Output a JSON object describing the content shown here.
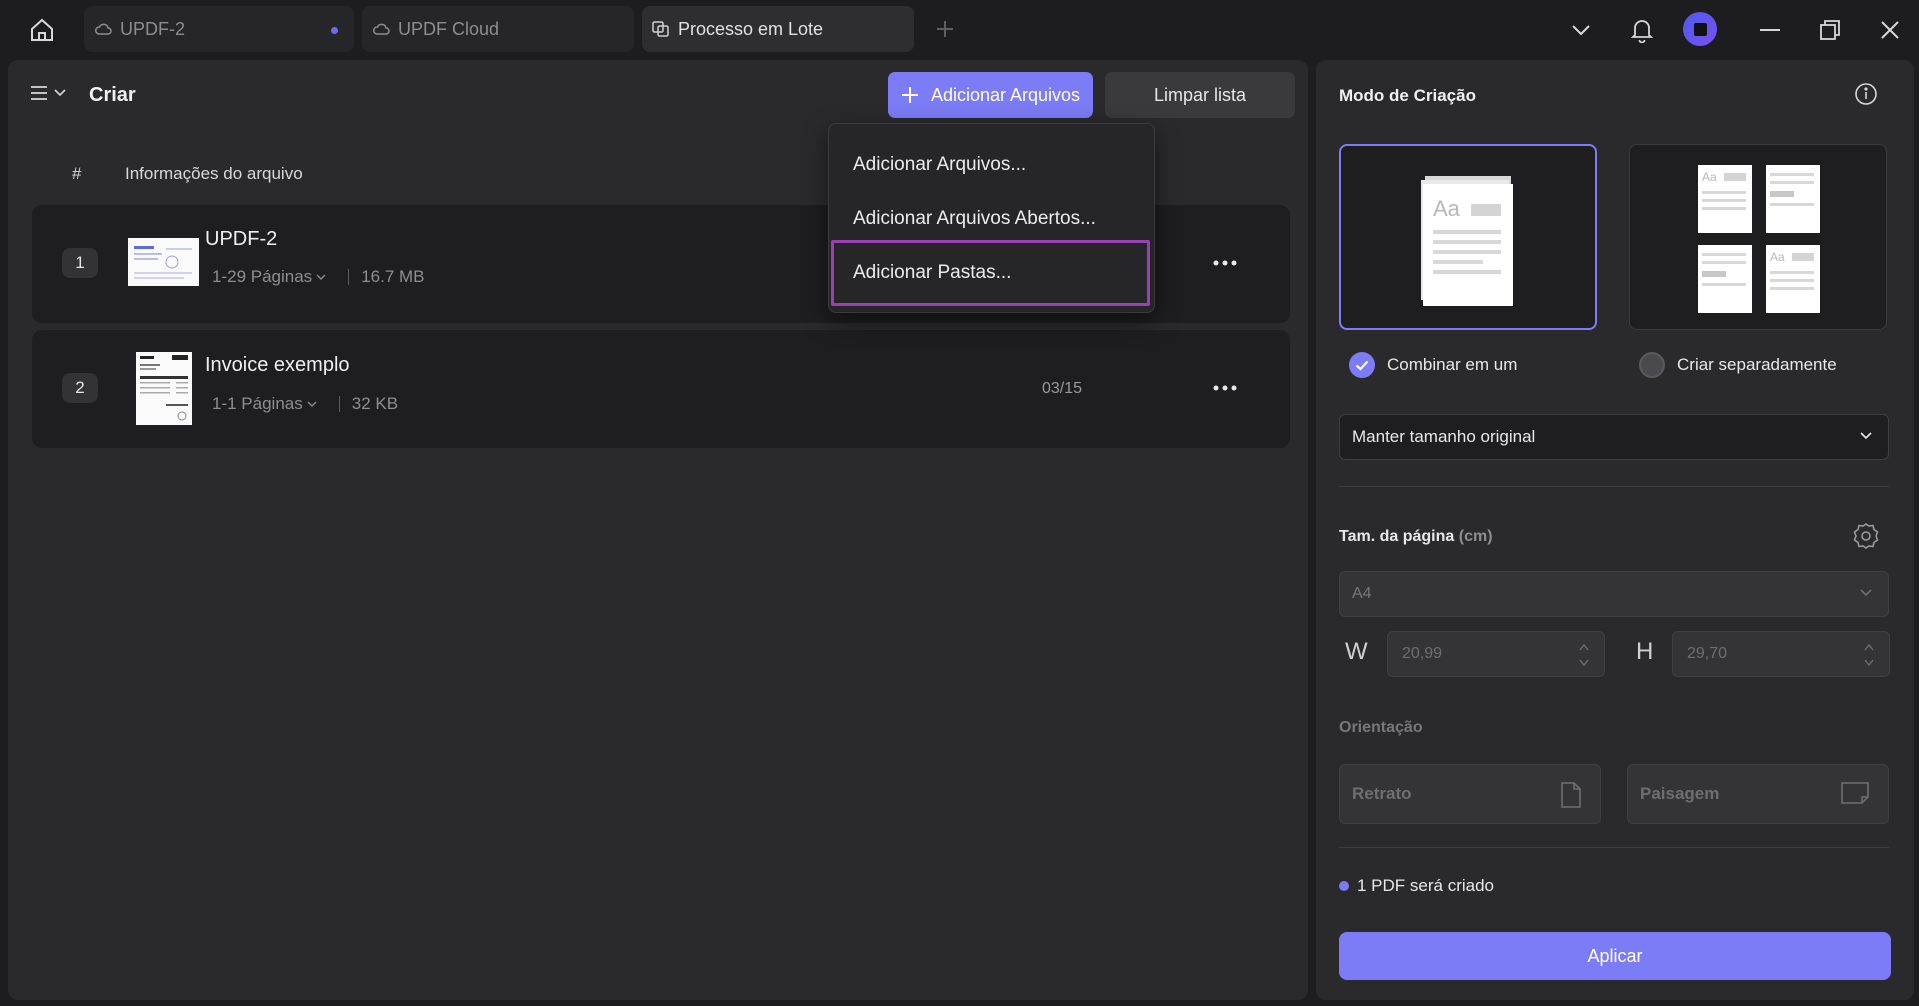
{
  "titlebar": {
    "tabs": [
      {
        "label": "UPDF-2"
      },
      {
        "label": "UPDF Cloud"
      },
      {
        "label": "Processo em Lote"
      }
    ]
  },
  "left": {
    "title": "Criar",
    "add_button": "Adicionar Arquivos",
    "clear_button": "Limpar lista",
    "columns": {
      "index": "#",
      "info": "Informações do arquivo"
    },
    "files": [
      {
        "index": "1",
        "name": "UPDF-2",
        "pages": "1-29 Páginas",
        "size": "16.7 MB",
        "range": ""
      },
      {
        "index": "2",
        "name": "Invoice exemplo",
        "pages": "1-1 Páginas",
        "size": "32 KB",
        "range": "03/15"
      }
    ],
    "dropdown": {
      "items": [
        "Adicionar Arquivos...",
        "Adicionar Arquivos Abertos...",
        "Adicionar Pastas..."
      ]
    }
  },
  "right": {
    "title": "Modo de Criação",
    "mode_options": [
      "Combinar em um",
      "Criar separadamente"
    ],
    "size_select": "Manter tamanho original",
    "page_size_title": "Tam. da página",
    "page_size_unit": "(cm)",
    "paper": "A4",
    "width_label": "W",
    "width_value": "20,99",
    "height_label": "H",
    "height_value": "29,70",
    "orientation_title": "Orientação",
    "orientation_options": [
      "Retrato",
      "Paisagem"
    ],
    "status": "1 PDF será criado",
    "apply_button": "Aplicar"
  },
  "colors": {
    "accent": "#7b7cf6",
    "highlight": "#9b3fb5",
    "bg": "#1d1d1f",
    "panel": "#2a2a2c"
  }
}
